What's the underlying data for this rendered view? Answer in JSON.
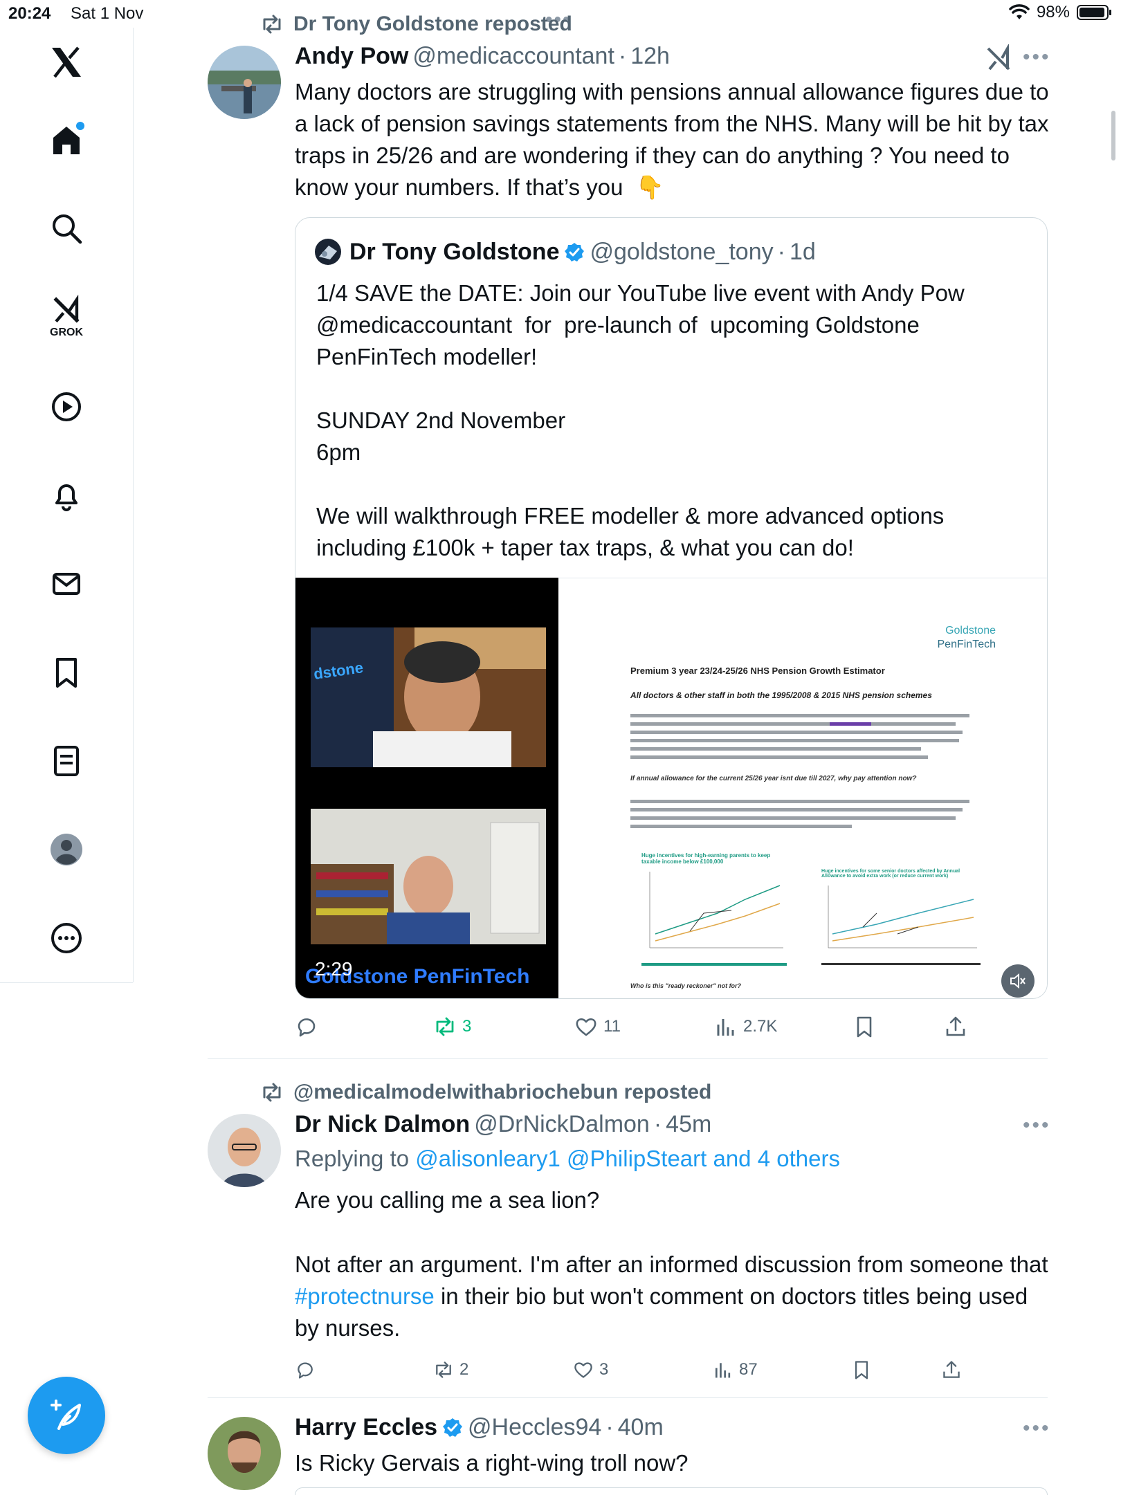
{
  "status_bar": {
    "time": "20:24",
    "date": "Sat 1 Nov",
    "battery": "98%"
  },
  "sidebar": {
    "items": [
      {
        "name": "x-logo-icon"
      },
      {
        "name": "home-icon"
      },
      {
        "name": "search-icon"
      },
      {
        "name": "grok-icon",
        "label": "GROK"
      },
      {
        "name": "video-icon"
      },
      {
        "name": "notifications-icon"
      },
      {
        "name": "messages-icon"
      },
      {
        "name": "bookmarks-icon"
      },
      {
        "name": "lists-icon"
      },
      {
        "name": "profile-icon"
      },
      {
        "name": "more-icon"
      }
    ],
    "compose_icon": "compose-icon"
  },
  "posts": [
    {
      "repost_by": "Dr Tony Goldstone reposted",
      "author": "Andy Pow",
      "handle": "@medicaccountant",
      "time": "12h",
      "text": "Many doctors are struggling with pensions annual allowance figures due to a lack of pension savings statements from the NHS. Many will be hit by tax traps in 25/26 and are wondering if they can do anything ? You need to know your numbers. If that’s you  👇",
      "quote": {
        "author": "Dr Tony Goldstone",
        "handle": "@goldstone_tony",
        "time": "1d",
        "text": "1/4 SAVE the DATE: Join our YouTube live event with Andy Pow @medicaccountant  for  pre-launch of  upcoming Goldstone PenFinTech modeller!\n\nSUNDAY 2nd November\n6pm\n\nWe will walkthrough FREE modeller & more advanced options including £100k + taper tax traps, & what you can do!",
        "video_duration": "2:29",
        "video_brand": "Goldstone PenFinTech",
        "video_logo_text": "dstone",
        "doc": {
          "brand_line1": "Goldstone",
          "brand_line2": "PenFinTech",
          "title": "Premium 3 year 23/24-25/26 NHS Pension Growth Estimator",
          "subtitle": "All doctors & other staff in both the 1995/2008 & 2015 NHS pension schemes",
          "question1": "If annual allowance for the current 25/26 year isnt due till 2027, why pay attention now?",
          "chart1_title": "Huge incentives for high-earning parents to keep taxable income below £100,000",
          "chart2_title": "Huge incentives for some senior doctors affected by Annual Allowance to avoid extra work (or reduce current work)",
          "question2": "Who is this \"ready reckoner\" not for?"
        }
      },
      "stats": {
        "replies": "",
        "reposts": "3",
        "likes": "11",
        "views": "2.7K"
      }
    },
    {
      "repost_by": "@medicalmodelwithabriochebun reposted",
      "author": "Dr Nick Dalmon",
      "handle": "@DrNickDalmon",
      "time": "45m",
      "replying_prefix": "Replying to",
      "replying_to": "@alisonleary1 @PhilipSteart and 4 others",
      "text_line1": "Are you calling me a sea lion?",
      "text_part1": "Not after an argument. I'm after an informed discussion from someone that ",
      "hashtag": "#protectnurse",
      "text_part2": " in their bio but won't comment on doctors titles being used by nurses.",
      "stats": {
        "replies": "",
        "reposts": "2",
        "likes": "3",
        "views": "87"
      }
    },
    {
      "author": "Harry Eccles",
      "handle": "@Heccles94",
      "time": "40m",
      "text": "Is Ricky Gervais a right-wing troll now?"
    }
  ]
}
